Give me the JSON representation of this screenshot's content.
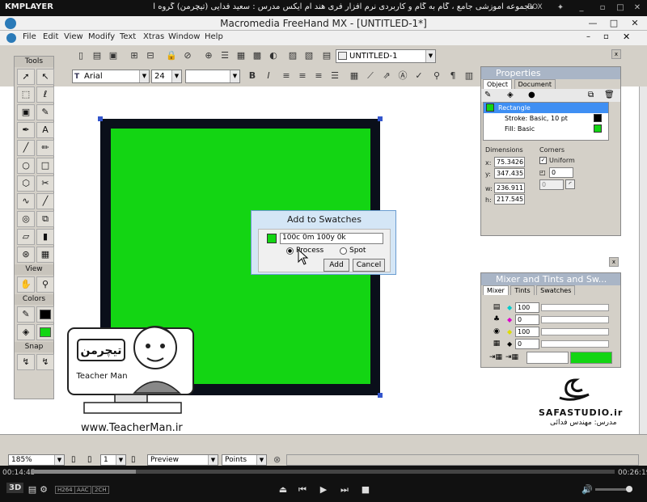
{
  "player": {
    "logo": "KMPLAYER",
    "title_text": "مجموعه آموزشی جامع ، گام به گام و کاربردی نرم افزار فری هند ام ایکس   مدرس : سعید فدایی (تیچرمن) گروه آموزشی پادشاه گرافیست ها",
    "box_label": "BOX",
    "time_elapsed": "00:14:45",
    "time_total": "00:26:19",
    "progress": 0.18,
    "badges": [
      "3D",
      "H264",
      "AAC",
      "2CH"
    ]
  },
  "app": {
    "title": "Macromedia FreeHand MX - [UNTITLED-1*]",
    "menu": [
      "File",
      "Edit",
      "View",
      "Modify",
      "Text",
      "Xtras",
      "Window",
      "Help"
    ],
    "doc_select": "UNTITLED-1",
    "font_name": "Arial",
    "font_size": "24",
    "text_style": "",
    "font_extra": ""
  },
  "tools_panel": {
    "title": "Tools",
    "view_label": "View",
    "colors_label": "Colors",
    "snap_label": "Snap",
    "stroke_color": "#000000",
    "fill_color": "#13d513"
  },
  "properties": {
    "title": "Properties",
    "tabs": [
      "Object",
      "Document"
    ],
    "object_name": "Rectangle",
    "stroke_row": "Stroke: Basic, 10 pt",
    "fill_row": "Fill: Basic",
    "dimensions_label": "Dimensions",
    "x_label": "x:",
    "x": "75.3426",
    "y_label": "y:",
    "y": "347.435",
    "w_label": "w:",
    "w": "236.911",
    "h_label": "h:",
    "h": "217.545",
    "corners_label": "Corners",
    "uniform_label": "Uniform",
    "corner_value": "0",
    "corner_value2": "0"
  },
  "mixer": {
    "title": "Mixer and Tints and Sw...",
    "tabs": [
      "Mixer",
      "Tints",
      "Swatches"
    ],
    "c": "100",
    "m": "0",
    "y": "100",
    "k": "0",
    "preview_color": "#13d513"
  },
  "dialog": {
    "title": "Add to Swatches",
    "name_value": "100c 0m 100y 0k",
    "swatch_color": "#13d513",
    "process_label": "Process",
    "spot_label": "Spot",
    "add_label": "Add",
    "cancel_label": "Cancel"
  },
  "status": {
    "zoom": "185%",
    "page": "1",
    "view_mode": "Preview",
    "units": "Points"
  },
  "overlay": {
    "logo_text": "تیچرمن",
    "logo_sub": "Teacher Man",
    "url": "www.TeacherMan.ir",
    "studio": "SAFASTUDIO.ir",
    "studio_sub": "مدرس: مهندس فدائی"
  }
}
